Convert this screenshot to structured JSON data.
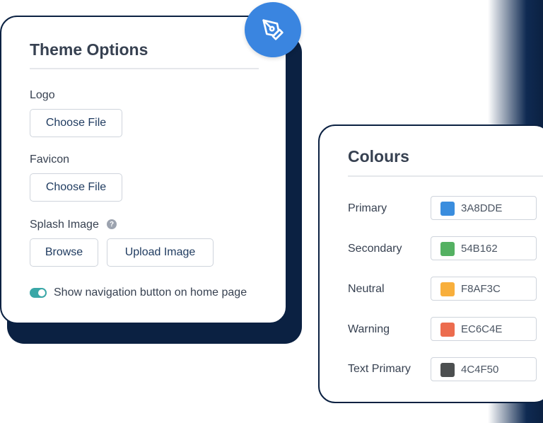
{
  "theme_options": {
    "title": "Theme Options",
    "logo_label": "Logo",
    "logo_button": "Choose File",
    "favicon_label": "Favicon",
    "favicon_button": "Choose File",
    "splash_label": "Splash Image",
    "splash_help": "?",
    "browse_button": "Browse",
    "upload_button": "Upload Image",
    "nav_toggle_label": "Show navigation button on home page",
    "nav_toggle_on": true,
    "fab_icon": "pen-nib-icon"
  },
  "colours": {
    "title": "Colours",
    "rows": [
      {
        "label": "Primary",
        "hex": "3A8DDE",
        "color": "#3A8DDE"
      },
      {
        "label": "Secondary",
        "hex": "54B162",
        "color": "#54B162"
      },
      {
        "label": "Neutral",
        "hex": "F8AF3C",
        "color": "#F8AF3C"
      },
      {
        "label": "Warning",
        "hex": "EC6C4E",
        "color": "#EC6C4E"
      },
      {
        "label": "Text Primary",
        "hex": "4C4F50",
        "color": "#4C4F50"
      }
    ]
  },
  "accent": {
    "navy": "#0b2142",
    "fab_blue": "#3a85e0",
    "toggle_teal": "#3aa7a7"
  }
}
